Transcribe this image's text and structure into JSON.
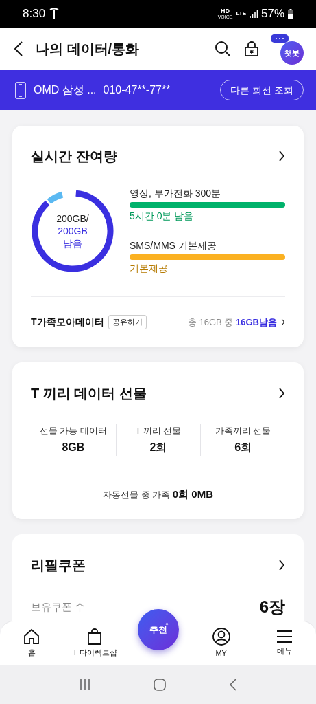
{
  "status_bar": {
    "time": "8:30",
    "indicators": [
      "HD",
      "VOICE",
      "LTE"
    ],
    "battery": "57%"
  },
  "header": {
    "title": "나의 데이터/통화",
    "chatbot": "챗봇"
  },
  "line_bar": {
    "device": "OMD 삼성 ...",
    "number": "010-47**-77**",
    "button": "다른 회선 조회"
  },
  "realtime": {
    "title": "실시간 잔여량",
    "donut": {
      "total": "200GB/",
      "remaining": "200GB",
      "remaining_label": "남음"
    },
    "items": [
      {
        "label": "영상, 부가전화 300분",
        "level": 1,
        "status": "5시간 0분 남음",
        "color": "#00b26b"
      },
      {
        "label": "SMS/MMS 기본제공",
        "level": 1,
        "status": "기본제공",
        "color": "#fbb121"
      }
    ],
    "family": {
      "label": "T가족모아데이터",
      "share_button": "공유하기",
      "summary": "총 16GB 중 ",
      "summary_bold": "16GB남음"
    }
  },
  "gift": {
    "title": "T 끼리 데이터 선물",
    "stats": [
      {
        "label": "선물 가능 데이터",
        "value": "8GB"
      },
      {
        "label": "T 끼리 선물",
        "value": "2회"
      },
      {
        "label": "가족끼리 선물",
        "value": "6회"
      }
    ],
    "auto": {
      "text": "자동선물 중 가족 ",
      "bold": "0회 0MB"
    }
  },
  "refill": {
    "title": "리필쿠폰",
    "coupon_label": "보유쿠폰 수",
    "coupon_value": "6장"
  },
  "bottom_nav": {
    "items": [
      {
        "kind": "home",
        "label": "홈"
      },
      {
        "kind": "shop",
        "label": "T 다이렉트샵"
      },
      {
        "kind": "my",
        "label": "MY"
      },
      {
        "kind": "menu",
        "label": "메뉴"
      }
    ],
    "center": "추천"
  }
}
